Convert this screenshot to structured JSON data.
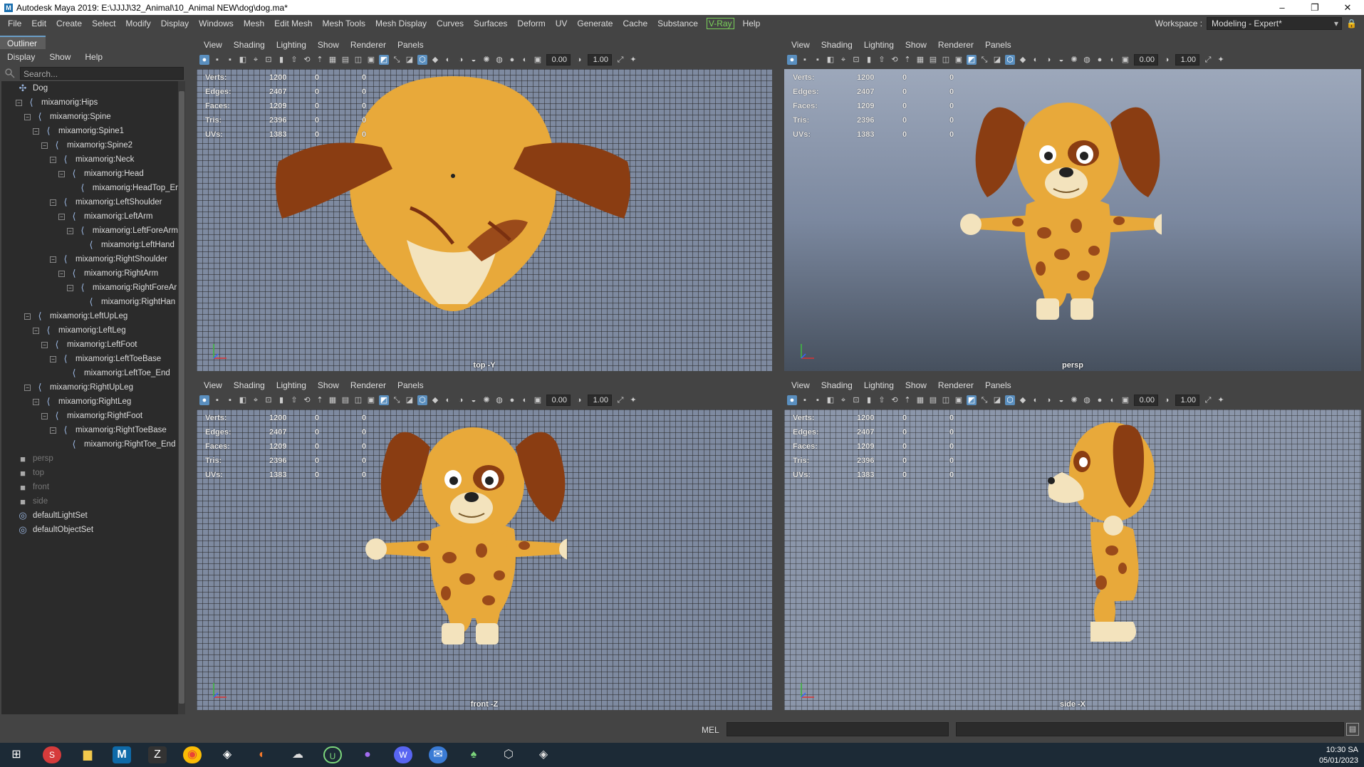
{
  "window": {
    "title": "Autodesk Maya 2019: E:\\JJJJ\\32_Animal\\10_Animal NEW\\dog\\dog.ma*",
    "minimize": "–",
    "restore": "❐",
    "close": "✕"
  },
  "menubar": [
    "File",
    "Edit",
    "Create",
    "Select",
    "Modify",
    "Display",
    "Windows",
    "Mesh",
    "Edit Mesh",
    "Mesh Tools",
    "Mesh Display",
    "Curves",
    "Surfaces",
    "Deform",
    "UV",
    "Generate",
    "Cache",
    "Substance",
    "V-Ray",
    "Help"
  ],
  "workspace": {
    "label": "Workspace :",
    "value": "Modeling - Expert*"
  },
  "outliner": {
    "tab": "Outliner",
    "menus": [
      "Display",
      "Show",
      "Help"
    ],
    "search_placeholder": "Search...",
    "items": [
      {
        "label": "Dog",
        "depth": 0,
        "icon": "joint-group-icon",
        "expander": "none"
      },
      {
        "label": "mixamorig:Hips",
        "depth": 1,
        "icon": "joint-icon",
        "expander": "minus"
      },
      {
        "label": "mixamorig:Spine",
        "depth": 2,
        "icon": "joint-icon",
        "expander": "minus"
      },
      {
        "label": "mixamorig:Spine1",
        "depth": 3,
        "icon": "joint-icon",
        "expander": "minus"
      },
      {
        "label": "mixamorig:Spine2",
        "depth": 4,
        "icon": "joint-icon",
        "expander": "minus"
      },
      {
        "label": "mixamorig:Neck",
        "depth": 5,
        "icon": "joint-icon",
        "expander": "minus"
      },
      {
        "label": "mixamorig:Head",
        "depth": 6,
        "icon": "joint-icon",
        "expander": "minus"
      },
      {
        "label": "mixamorig:HeadTop_Er",
        "depth": 7,
        "icon": "joint-icon",
        "expander": "none"
      },
      {
        "label": "mixamorig:LeftShoulder",
        "depth": 5,
        "icon": "joint-icon",
        "expander": "minus"
      },
      {
        "label": "mixamorig:LeftArm",
        "depth": 6,
        "icon": "joint-icon",
        "expander": "minus"
      },
      {
        "label": "mixamorig:LeftForeArm",
        "depth": 7,
        "icon": "joint-icon",
        "expander": "minus"
      },
      {
        "label": "mixamorig:LeftHand",
        "depth": 8,
        "icon": "joint-icon",
        "expander": "none"
      },
      {
        "label": "mixamorig:RightShoulder",
        "depth": 5,
        "icon": "joint-icon",
        "expander": "minus"
      },
      {
        "label": "mixamorig:RightArm",
        "depth": 6,
        "icon": "joint-icon",
        "expander": "minus"
      },
      {
        "label": "mixamorig:RightForeAr",
        "depth": 7,
        "icon": "joint-icon",
        "expander": "minus"
      },
      {
        "label": "mixamorig:RightHan",
        "depth": 8,
        "icon": "joint-icon",
        "expander": "none"
      },
      {
        "label": "mixamorig:LeftUpLeg",
        "depth": 2,
        "icon": "joint-icon",
        "expander": "minus"
      },
      {
        "label": "mixamorig:LeftLeg",
        "depth": 3,
        "icon": "joint-icon",
        "expander": "minus"
      },
      {
        "label": "mixamorig:LeftFoot",
        "depth": 4,
        "icon": "joint-icon",
        "expander": "minus"
      },
      {
        "label": "mixamorig:LeftToeBase",
        "depth": 5,
        "icon": "joint-icon",
        "expander": "minus"
      },
      {
        "label": "mixamorig:LeftToe_End",
        "depth": 6,
        "icon": "joint-icon",
        "expander": "none"
      },
      {
        "label": "mixamorig:RightUpLeg",
        "depth": 2,
        "icon": "joint-icon",
        "expander": "minus"
      },
      {
        "label": "mixamorig:RightLeg",
        "depth": 3,
        "icon": "joint-icon",
        "expander": "minus"
      },
      {
        "label": "mixamorig:RightFoot",
        "depth": 4,
        "icon": "joint-icon",
        "expander": "minus"
      },
      {
        "label": "mixamorig:RightToeBase",
        "depth": 5,
        "icon": "joint-icon",
        "expander": "minus"
      },
      {
        "label": "mixamorig:RightToe_End",
        "depth": 6,
        "icon": "joint-icon",
        "expander": "none"
      },
      {
        "label": "persp",
        "depth": 0,
        "icon": "camera-icon",
        "expander": "none",
        "dim": true
      },
      {
        "label": "top",
        "depth": 0,
        "icon": "camera-icon",
        "expander": "none",
        "dim": true
      },
      {
        "label": "front",
        "depth": 0,
        "icon": "camera-icon",
        "expander": "none",
        "dim": true
      },
      {
        "label": "side",
        "depth": 0,
        "icon": "camera-icon",
        "expander": "none",
        "dim": true
      },
      {
        "label": "defaultLightSet",
        "depth": 0,
        "icon": "set-icon",
        "expander": "none"
      },
      {
        "label": "defaultObjectSet",
        "depth": 0,
        "icon": "set-icon",
        "expander": "none"
      }
    ]
  },
  "viewport_menu": [
    "View",
    "Shading",
    "Lighting",
    "Show",
    "Renderer",
    "Panels"
  ],
  "viewport_fields": {
    "exposure": "0.00",
    "gamma": "1.00"
  },
  "hud": {
    "rows": [
      {
        "label": "Verts:",
        "a": "1200",
        "b": "0",
        "c": "0"
      },
      {
        "label": "Edges:",
        "a": "2407",
        "b": "0",
        "c": "0"
      },
      {
        "label": "Faces:",
        "a": "1209",
        "b": "0",
        "c": "0"
      },
      {
        "label": "Tris:",
        "a": "2396",
        "b": "0",
        "c": "0"
      },
      {
        "label": "UVs:",
        "a": "1383",
        "b": "0",
        "c": "0"
      }
    ]
  },
  "viewports": {
    "top": "top -Y",
    "persp": "persp",
    "front": "front -Z",
    "side": "side -X"
  },
  "cmd": {
    "mel": "MEL"
  },
  "taskbar": {
    "time": "10:30 SA",
    "date": "05/01/2023"
  },
  "colors": {
    "dog_body": "#e8a93a",
    "dog_ear": "#8a3d12",
    "dog_muzzle": "#f3e3bd",
    "spot": "#9a4a1a"
  }
}
